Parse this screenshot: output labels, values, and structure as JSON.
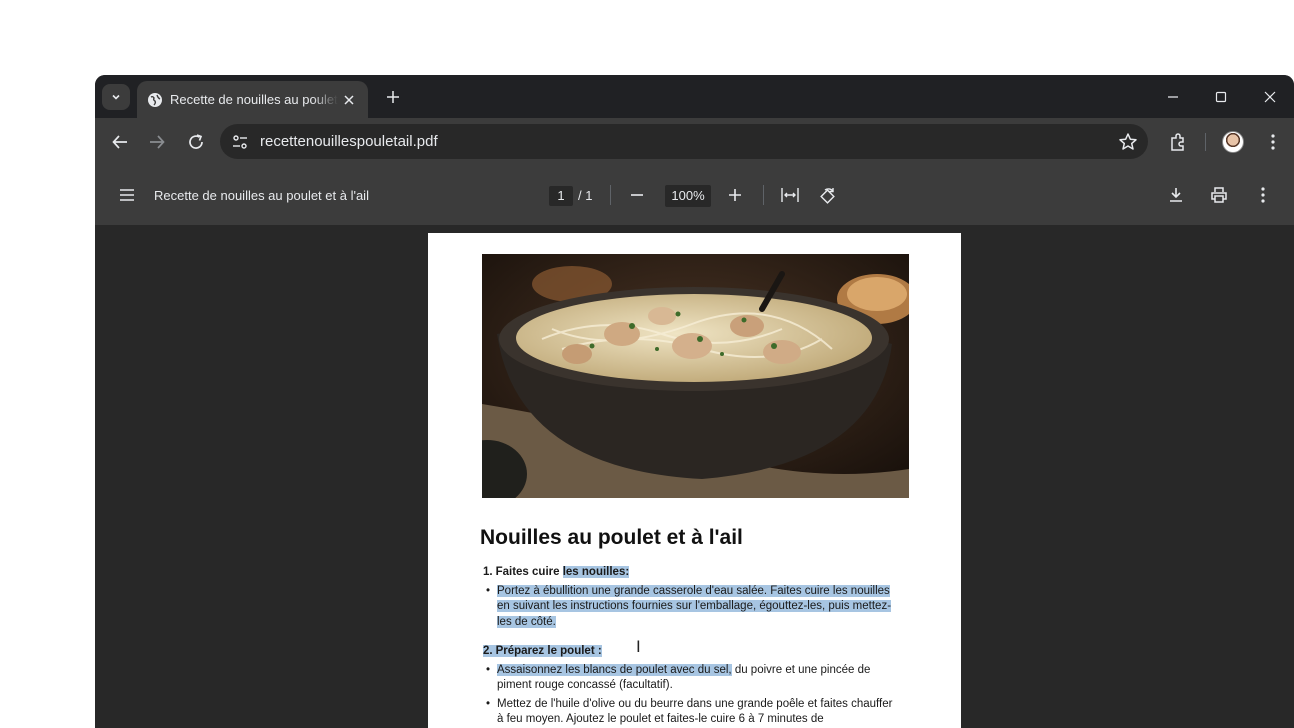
{
  "browser": {
    "tab_title": "Recette de nouilles au poulet et à l'ail",
    "url": "recettenouillespouletail.pdf"
  },
  "pdf_toolbar": {
    "title": "Recette de nouilles au poulet et à l'ail",
    "current_page": "1",
    "page_total": "/ 1",
    "zoom": "100%"
  },
  "document": {
    "heading": "Nouilles au poulet et à l'ail",
    "step1": {
      "num": "1.",
      "text_plain": "Faites cuire ",
      "text_highlight": "les nouilles:",
      "bullet": "Portez à ébullition une grande casserole d'eau salée. Faites cuire les nouilles en suivant les instructions fournies sur l'emballage, égouttez-les, puis mettez-les de côté."
    },
    "step2": {
      "num": "2.",
      "text": "Préparez le poulet :",
      "bullet1_highlight": "Assaisonnez les blancs de poulet avec du sel,",
      "bullet1_rest": " du poivre et une pincée de piment rouge concassé (facultatif).",
      "bullet2": "Mettez de l'huile d'olive ou du beurre dans une grande poêle et faites chauffer à feu moyen. Ajoutez le poulet et faites-le cuire 6 à 7 minutes de"
    }
  },
  "icons": [
    "chevron-down-icon",
    "globe-icon",
    "close-icon",
    "plus-icon",
    "minimize-icon",
    "maximize-icon",
    "back-icon",
    "forward-icon",
    "reload-icon",
    "tune-icon",
    "star-icon",
    "extensions-icon",
    "more-icon",
    "menu-icon",
    "minus-icon",
    "fit-width-icon",
    "rotate-icon",
    "download-icon",
    "print-icon",
    "text-cursor-icon"
  ]
}
